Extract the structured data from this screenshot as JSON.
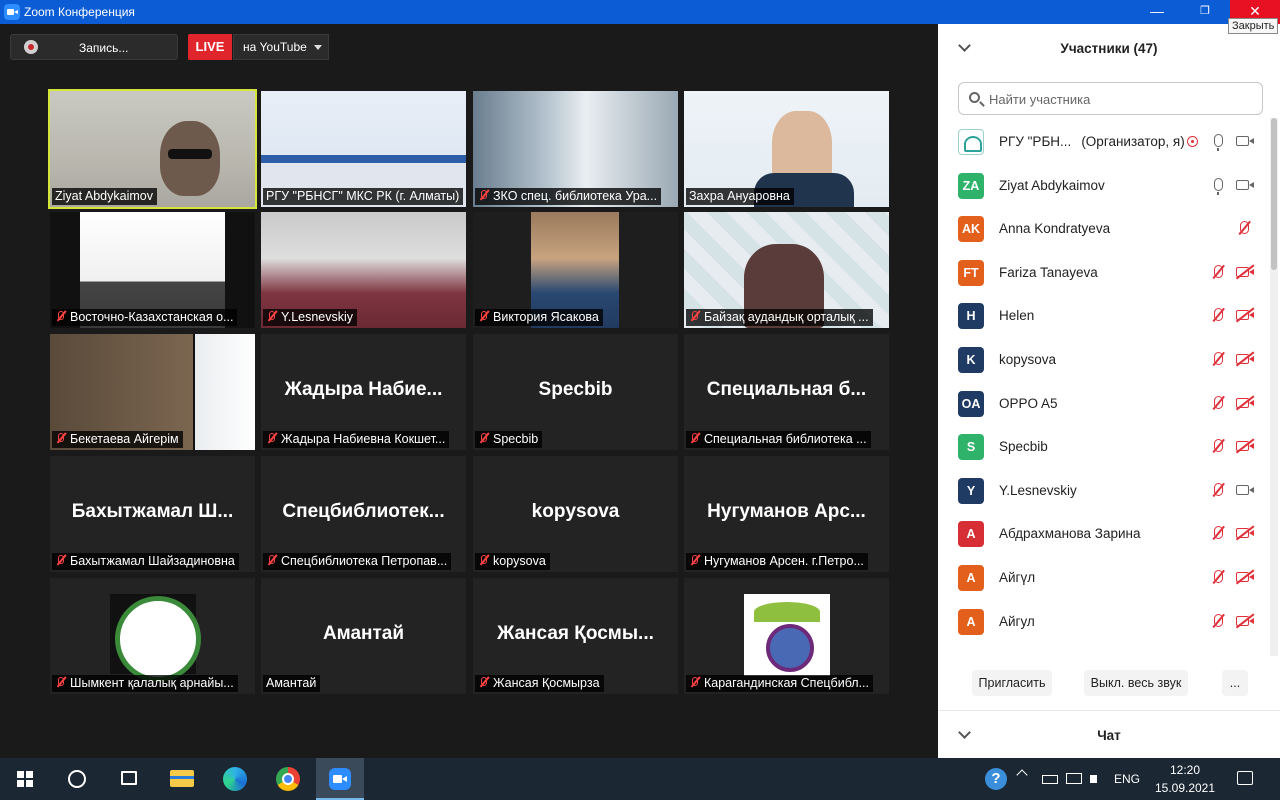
{
  "window": {
    "title": "Zoom Конференция",
    "min_glyph": "—",
    "max_glyph": "❐",
    "close_glyph": "✕",
    "close_tooltip": "Закрыть"
  },
  "toolbar": {
    "record_label": "Запись...",
    "live_label": "LIVE",
    "youtube_label": "на YouTube"
  },
  "tiles": [
    {
      "name": "Ziyat Abdykaimov",
      "big": "",
      "muted": false,
      "kind": "video",
      "active": true
    },
    {
      "name": "РГУ \"РБНСГ\" МКС РК (г. Алматы)",
      "big": "",
      "muted": false,
      "kind": "video",
      "active": false
    },
    {
      "name": "ЗКО спец. библиотека Ура...",
      "big": "",
      "muted": true,
      "kind": "video",
      "active": false
    },
    {
      "name": "Захра Ануаровна",
      "big": "",
      "muted": false,
      "kind": "video",
      "active": false
    },
    {
      "name": "Восточно-Казахстанская о...",
      "big": "",
      "muted": true,
      "kind": "video",
      "active": false
    },
    {
      "name": "Y.Lesnevskiy",
      "big": "",
      "muted": true,
      "kind": "video",
      "active": false
    },
    {
      "name": "Виктория Ясакова",
      "big": "",
      "muted": true,
      "kind": "video",
      "active": false
    },
    {
      "name": "Байзақ аудандық орталық ...",
      "big": "",
      "muted": true,
      "kind": "video",
      "active": false
    },
    {
      "name": "Бекетаева Айгерім",
      "big": "",
      "muted": true,
      "kind": "video",
      "active": false
    },
    {
      "name": "Жадыра Набиевна Кокшет...",
      "big": "Жадыра Набие...",
      "muted": true,
      "kind": "name",
      "active": false
    },
    {
      "name": "Specbib",
      "big": "Specbib",
      "muted": true,
      "kind": "name",
      "active": false
    },
    {
      "name": "Специальная библиотека ...",
      "big": "Специальная б...",
      "muted": true,
      "kind": "name",
      "active": false
    },
    {
      "name": "Бахытжамал Шайзадиновна",
      "big": "Бахытжамал Ш...",
      "muted": true,
      "kind": "name",
      "active": false
    },
    {
      "name": "Спецбиблиотека Петропав...",
      "big": "Спецбиблиотек...",
      "muted": true,
      "kind": "name",
      "active": false
    },
    {
      "name": "kopysova",
      "big": "kopysova",
      "muted": true,
      "kind": "name",
      "active": false
    },
    {
      "name": "Нугуманов Арсен. г.Петро...",
      "big": "Нугуманов Арс...",
      "muted": true,
      "kind": "name",
      "active": false
    },
    {
      "name": "Шымкент қалалық арнайы...",
      "big": "",
      "muted": true,
      "kind": "logo",
      "active": false
    },
    {
      "name": "Амантай",
      "big": "Амантай",
      "muted": false,
      "kind": "name",
      "active": false
    },
    {
      "name": "Жансая Қосмырза",
      "big": "Жансая Қосмы...",
      "muted": true,
      "kind": "name",
      "active": false
    },
    {
      "name": "Карагандинская Спецбибл...",
      "big": "",
      "muted": true,
      "kind": "logo2",
      "active": false
    }
  ],
  "panel": {
    "title": "Участники (47)",
    "search_placeholder": "Найти участника",
    "participants": [
      {
        "initials": "",
        "color": "#ffffff",
        "name": "РГУ \"РБН...",
        "tag": "(Организатор, я)",
        "mic": "on",
        "cam": "on",
        "rec": true
      },
      {
        "initials": "ZA",
        "color": "#2fb36b",
        "name": "Ziyat Abdykaimov",
        "tag": "",
        "mic": "on",
        "cam": "on",
        "rec": false
      },
      {
        "initials": "AK",
        "color": "#e35f1c",
        "name": "Anna Kondratyeva",
        "tag": "",
        "mic": "off",
        "cam": "none",
        "rec": false
      },
      {
        "initials": "FT",
        "color": "#e35f1c",
        "name": "Fariza Tanayeva",
        "tag": "",
        "mic": "off",
        "cam": "off",
        "rec": false
      },
      {
        "initials": "H",
        "color": "#1f3b63",
        "name": "Helen",
        "tag": "",
        "mic": "off",
        "cam": "off",
        "rec": false
      },
      {
        "initials": "K",
        "color": "#1f3b63",
        "name": "kopysova",
        "tag": "",
        "mic": "off",
        "cam": "off",
        "rec": false
      },
      {
        "initials": "OA",
        "color": "#1f3b63",
        "name": "OPPO A5",
        "tag": "",
        "mic": "off",
        "cam": "off",
        "rec": false
      },
      {
        "initials": "S",
        "color": "#2fb36b",
        "name": "Specbib",
        "tag": "",
        "mic": "off",
        "cam": "off",
        "rec": false
      },
      {
        "initials": "Y",
        "color": "#1f3b63",
        "name": "Y.Lesnevskiy",
        "tag": "",
        "mic": "off",
        "cam": "on",
        "rec": false
      },
      {
        "initials": "A",
        "color": "#d62e34",
        "name": "Абдрахманова Зарина",
        "tag": "",
        "mic": "off",
        "cam": "off",
        "rec": false
      },
      {
        "initials": "A",
        "color": "#e35f1c",
        "name": "Айгүл",
        "tag": "",
        "mic": "off",
        "cam": "off",
        "rec": false
      },
      {
        "initials": "A",
        "color": "#e35f1c",
        "name": "Айгул",
        "tag": "",
        "mic": "off",
        "cam": "off",
        "rec": false
      }
    ],
    "invite_label": "Пригласить",
    "muteall_label": "Выкл. весь звук",
    "more_label": "...",
    "chat_title": "Чат"
  },
  "taskbar": {
    "help_glyph": "?",
    "lang": "ENG",
    "time": "12:20",
    "date": "15.09.2021"
  },
  "colors": {
    "titlebar": "#0b5cd5",
    "live": "#e0262c",
    "muted_red": "#e0303a",
    "active_speaker": "#d4e63a"
  }
}
